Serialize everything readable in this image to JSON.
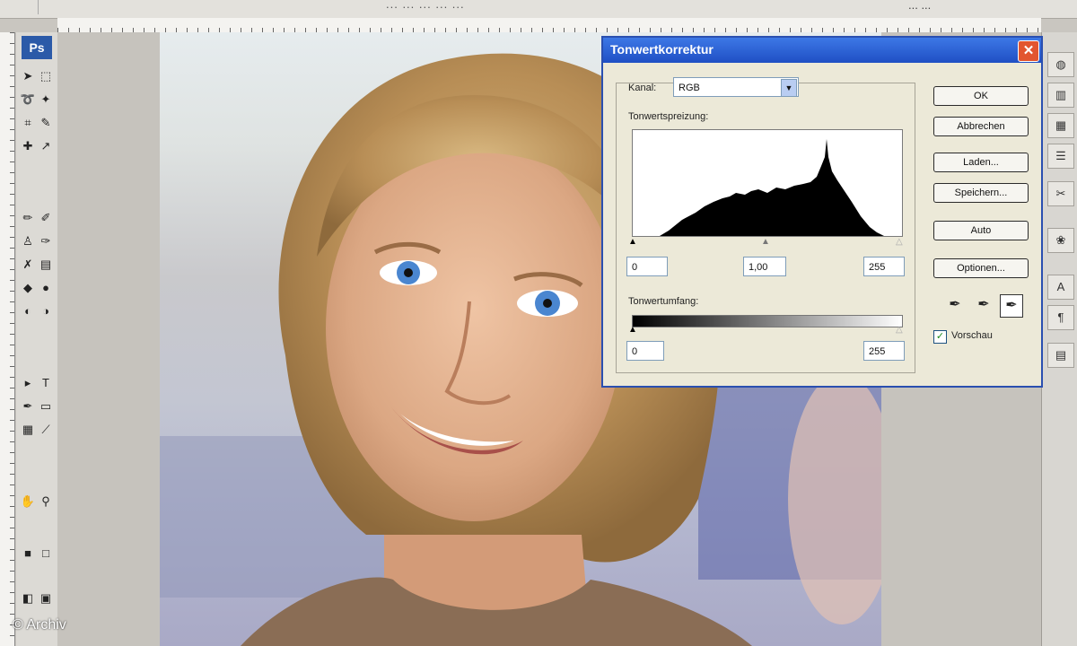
{
  "app": {
    "logo": "Ps",
    "doc_title": "... ... ... ... ...",
    "workspace": "... ..."
  },
  "dialog": {
    "title": "Tonwertkorrektur",
    "channel_label": "Kanal:",
    "channel_value": "RGB",
    "input_levels_label": "Tonwertspreizung:",
    "input_black": "0",
    "input_gamma": "1,00",
    "input_white": "255",
    "output_levels_label": "Tonwertumfang:",
    "output_black": "0",
    "output_white": "255",
    "buttons": {
      "ok": "OK",
      "cancel": "Abbrechen",
      "load": "Laden...",
      "save": "Speichern...",
      "auto": "Auto",
      "options": "Optionen..."
    },
    "preview_label": "Vorschau",
    "preview_checked": true
  },
  "credit": "© Archiv",
  "colors": {
    "titlebar": "#2a5ad0",
    "accent": "#2b5aa8"
  }
}
